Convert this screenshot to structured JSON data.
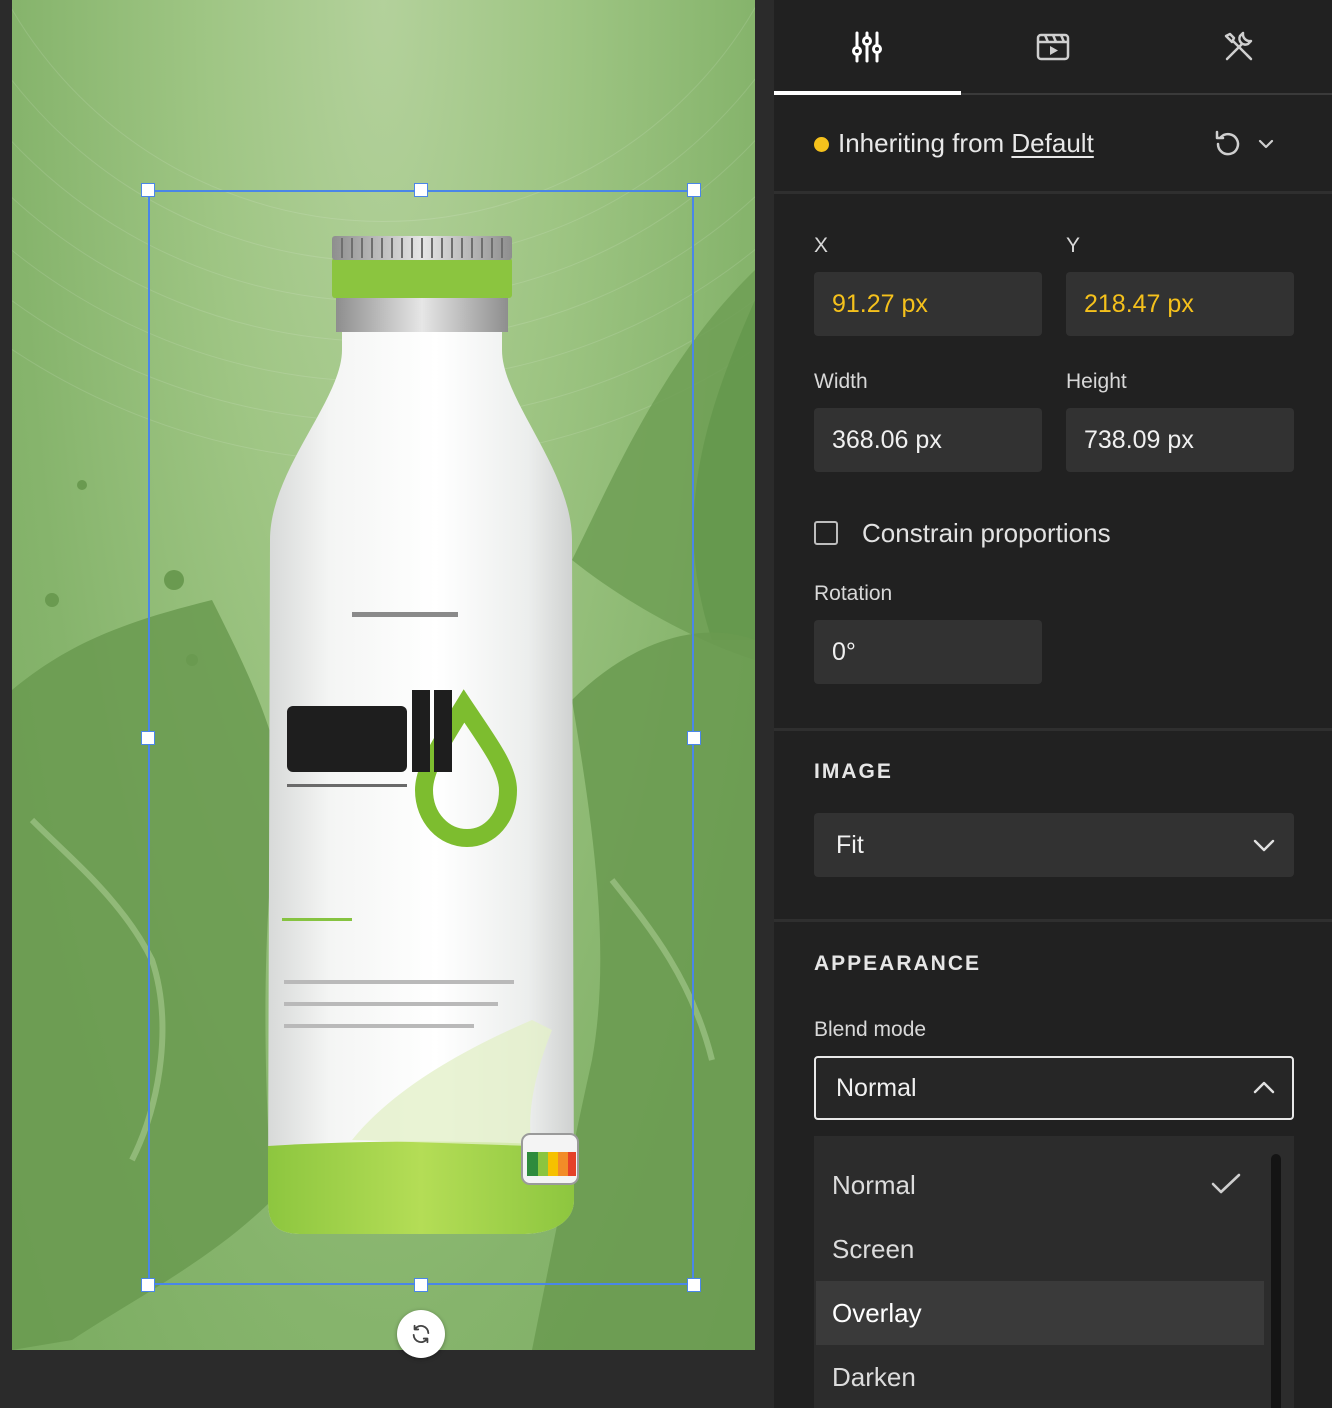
{
  "panel": {
    "tabs": [
      {
        "icon": "sliders-icon",
        "active": true
      },
      {
        "icon": "film-clapper-icon",
        "active": false
      },
      {
        "icon": "tools-icon",
        "active": false
      }
    ],
    "inherit": {
      "prefix": "Inheriting from ",
      "link": "Default",
      "dot_color": "#f5c11c"
    },
    "position": {
      "x_label": "X",
      "x_value": "91.27 px",
      "y_label": "Y",
      "y_value": "218.47 px",
      "width_label": "Width",
      "width_value": "368.06 px",
      "height_label": "Height",
      "height_value": "738.09 px",
      "constrain_label": "Constrain proportions",
      "constrain_checked": false,
      "rotation_label": "Rotation",
      "rotation_value": "0°"
    },
    "image": {
      "title": "IMAGE",
      "fit_value": "Fit"
    },
    "appearance": {
      "title": "APPEARANCE",
      "blend_label": "Blend mode",
      "blend_value": "Normal",
      "blend_options": [
        "Normal",
        "Screen",
        "Overlay",
        "Darken"
      ],
      "blend_selected": "Normal",
      "blend_hovered": "Overlay"
    }
  },
  "canvas": {
    "background_color": "#8fbb74",
    "selected_object": "bottle-image"
  },
  "colors": {
    "accent": "#f5c11c",
    "selection": "#4a86e8",
    "panel_bg": "#212121"
  }
}
